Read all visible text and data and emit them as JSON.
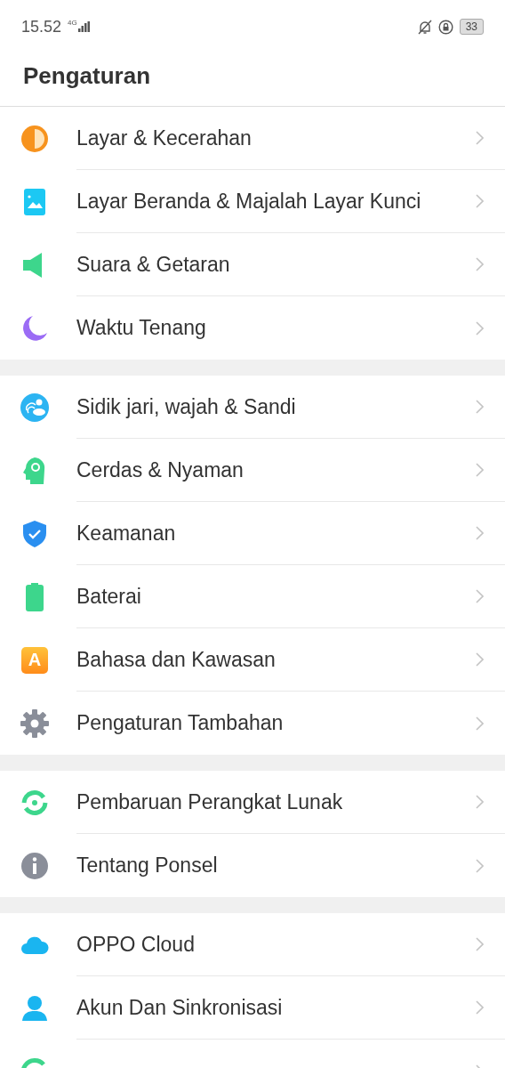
{
  "status_bar": {
    "time": "15.52",
    "network": "4G",
    "battery": "33"
  },
  "title": "Pengaturan",
  "sections": [
    {
      "items": [
        {
          "label": "Layar &  Kecerahan",
          "kind": "contrast"
        },
        {
          "label": "Layar Beranda & Majalah Layar Kunci",
          "kind": "wallpaper"
        },
        {
          "label": "Suara & Getaran",
          "kind": "speaker"
        },
        {
          "label": "Waktu Tenang",
          "kind": "moon"
        }
      ]
    },
    {
      "items": [
        {
          "label": "Sidik jari, wajah & Sandi",
          "kind": "fingerprint"
        },
        {
          "label": "Cerdas & Nyaman",
          "kind": "head"
        },
        {
          "label": "Keamanan",
          "kind": "shield"
        },
        {
          "label": "Baterai",
          "kind": "battery"
        },
        {
          "label": "Bahasa dan Kawasan",
          "kind": "letter",
          "icon_text": "A"
        },
        {
          "label": "Pengaturan Tambahan",
          "kind": "gear"
        }
      ]
    },
    {
      "items": [
        {
          "label": "Pembaruan Perangkat Lunak",
          "kind": "update"
        },
        {
          "label": "Tentang Ponsel",
          "kind": "info"
        }
      ]
    },
    {
      "items": [
        {
          "label": "OPPO Cloud",
          "kind": "cloud"
        },
        {
          "label": "Akun Dan Sinkronisasi",
          "kind": "person"
        },
        {
          "kind": "ring"
        }
      ]
    }
  ]
}
